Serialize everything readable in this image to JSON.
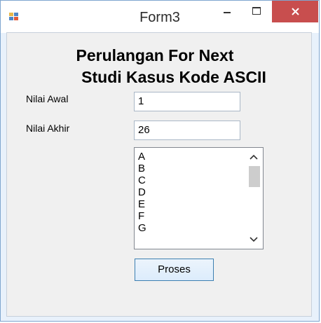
{
  "window": {
    "title": "Form3",
    "icon": "winforms-app-icon",
    "close_color": "#c84e4e"
  },
  "form": {
    "heading_line1": "Perulangan For Next",
    "heading_line2": "Studi Kasus Kode ASCII",
    "label_start": "Nilai Awal",
    "label_end": "Nilai Akhir",
    "value_start": "1",
    "value_end": "26",
    "list_items": [
      "A",
      "B",
      "C",
      "D",
      "E",
      "F",
      "G"
    ],
    "button_label": "Proses"
  }
}
